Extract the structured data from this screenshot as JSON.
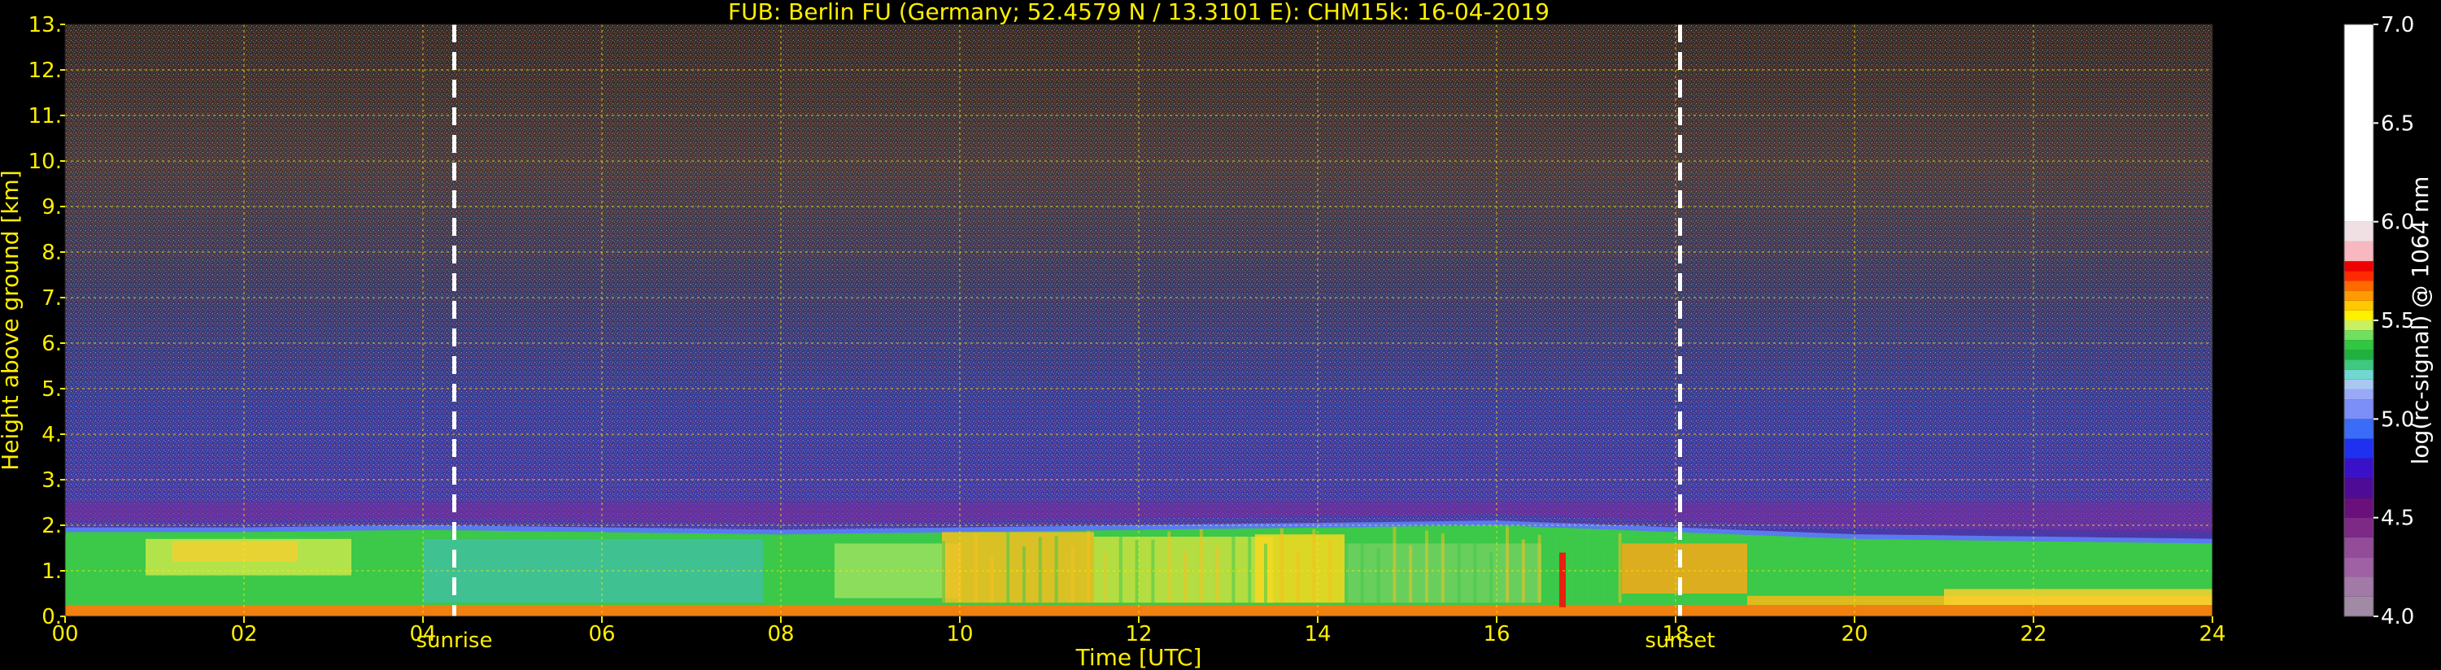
{
  "chart_data": {
    "type": "heatmap",
    "title": "FUB: Berlin FU (Germany; 52.4579 N / 13.3101 E):    CHM15k: 16-04-2019",
    "xlabel": "Time [UTC]",
    "ylabel": "Height above ground [km]",
    "xlim": [
      0,
      24
    ],
    "ylim": [
      0,
      13
    ],
    "x_ticks": [
      {
        "value": 0,
        "label": "00"
      },
      {
        "value": 2,
        "label": "02"
      },
      {
        "value": 4,
        "label": "04"
      },
      {
        "value": 6,
        "label": "06"
      },
      {
        "value": 8,
        "label": "08"
      },
      {
        "value": 10,
        "label": "10"
      },
      {
        "value": 12,
        "label": "12"
      },
      {
        "value": 14,
        "label": "14"
      },
      {
        "value": 16,
        "label": "16"
      },
      {
        "value": 18,
        "label": "18"
      },
      {
        "value": 20,
        "label": "20"
      },
      {
        "value": 22,
        "label": "22"
      },
      {
        "value": 24,
        "label": "24"
      }
    ],
    "y_ticks": [
      {
        "value": 0,
        "label": "0."
      },
      {
        "value": 1,
        "label": "1."
      },
      {
        "value": 2,
        "label": "2."
      },
      {
        "value": 3,
        "label": "3."
      },
      {
        "value": 4,
        "label": "4."
      },
      {
        "value": 5,
        "label": "5."
      },
      {
        "value": 6,
        "label": "6."
      },
      {
        "value": 7,
        "label": "7."
      },
      {
        "value": 8,
        "label": "8."
      },
      {
        "value": 9,
        "label": "9."
      },
      {
        "value": 10,
        "label": "10."
      },
      {
        "value": 11,
        "label": "11."
      },
      {
        "value": 12,
        "label": "12."
      },
      {
        "value": 13,
        "label": "13."
      }
    ],
    "grid": true,
    "grid_color": "#ffee00",
    "events": [
      {
        "name": "sunrise",
        "time": 4.35,
        "line_color": "#ffffff"
      },
      {
        "name": "sunset",
        "time": 18.05,
        "line_color": "#ffffff"
      }
    ],
    "boundary_layer": {
      "top_km_by_hour": [
        {
          "t": 0,
          "h": 1.85
        },
        {
          "t": 2,
          "h": 1.85
        },
        {
          "t": 4,
          "h": 1.9
        },
        {
          "t": 6,
          "h": 1.85
        },
        {
          "t": 8,
          "h": 1.8
        },
        {
          "t": 10,
          "h": 1.85
        },
        {
          "t": 12,
          "h": 1.9
        },
        {
          "t": 14,
          "h": 1.95
        },
        {
          "t": 16,
          "h": 2.0
        },
        {
          "t": 18,
          "h": 1.85
        },
        {
          "t": 20,
          "h": 1.7
        },
        {
          "t": 22,
          "h": 1.65
        },
        {
          "t": 24,
          "h": 1.6
        }
      ]
    },
    "colorbar": {
      "label": "log(rc-signal) @ 1064 nm",
      "min": 4.0,
      "max": 7.0,
      "ticks": [
        {
          "value": 4.0,
          "label": "4.0"
        },
        {
          "value": 4.5,
          "label": "4.5"
        },
        {
          "value": 5.0,
          "label": "5.0"
        },
        {
          "value": 5.5,
          "label": "5.5"
        },
        {
          "value": 6.0,
          "label": "6.0"
        },
        {
          "value": 6.5,
          "label": "6.5"
        },
        {
          "value": 7.0,
          "label": "7.0"
        }
      ],
      "levels": [
        {
          "value": 4.0,
          "color": "#a08aa4"
        },
        {
          "value": 4.1,
          "color": "#a27aa6"
        },
        {
          "value": 4.2,
          "color": "#a060a4"
        },
        {
          "value": 4.3,
          "color": "#924c98"
        },
        {
          "value": 4.4,
          "color": "#7c2a86"
        },
        {
          "value": 4.5,
          "color": "#6a107a"
        },
        {
          "value": 4.6,
          "color": "#4e0c96"
        },
        {
          "value": 4.7,
          "color": "#3a10c8"
        },
        {
          "value": 4.8,
          "color": "#2030f0"
        },
        {
          "value": 4.9,
          "color": "#3a6cf8"
        },
        {
          "value": 5.0,
          "color": "#7c8ef8"
        },
        {
          "value": 5.1,
          "color": "#9aa8f8"
        },
        {
          "value": 5.15,
          "color": "#a8c8f0"
        },
        {
          "value": 5.2,
          "color": "#70d8d0"
        },
        {
          "value": 5.25,
          "color": "#40c880"
        },
        {
          "value": 5.3,
          "color": "#20b040"
        },
        {
          "value": 5.35,
          "color": "#30c840"
        },
        {
          "value": 5.4,
          "color": "#70e060"
        },
        {
          "value": 5.45,
          "color": "#c8f060"
        },
        {
          "value": 5.5,
          "color": "#fff000"
        },
        {
          "value": 5.55,
          "color": "#ffc800"
        },
        {
          "value": 5.6,
          "color": "#ff9a00"
        },
        {
          "value": 5.65,
          "color": "#ff6a00"
        },
        {
          "value": 5.7,
          "color": "#ff2a00"
        },
        {
          "value": 5.75,
          "color": "#f00000"
        },
        {
          "value": 5.8,
          "color": "#f8b8c0"
        },
        {
          "value": 5.9,
          "color": "#f0e0e4"
        },
        {
          "value": 6.0,
          "color": "#ffffff"
        }
      ]
    }
  }
}
